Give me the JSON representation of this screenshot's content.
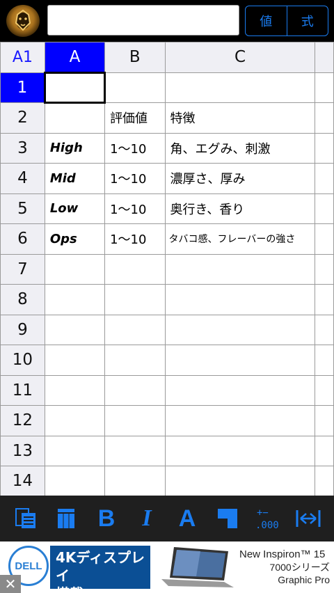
{
  "toolbar_top": {
    "formula_value": "",
    "mode_value": "値",
    "mode_formula": "式"
  },
  "grid": {
    "corner": "A1",
    "columns": [
      "A",
      "B",
      "C"
    ],
    "rows": [
      {
        "num": "1",
        "a": "",
        "b": "",
        "c": ""
      },
      {
        "num": "2",
        "a": "",
        "b": "評価値",
        "c": "特徴"
      },
      {
        "num": "3",
        "a": "High",
        "b": "1〜10",
        "c": "角、エグみ、刺激"
      },
      {
        "num": "4",
        "a": "Mid",
        "b": "1〜10",
        "c": "濃厚さ、厚み"
      },
      {
        "num": "5",
        "a": "Low",
        "b": "1〜10",
        "c": "奥行き、香り"
      },
      {
        "num": "6",
        "a": "Ops",
        "b": "1〜10",
        "c": "タバコ感、フレーバーの強さ"
      },
      {
        "num": "7",
        "a": "",
        "b": "",
        "c": ""
      },
      {
        "num": "8",
        "a": "",
        "b": "",
        "c": ""
      },
      {
        "num": "9",
        "a": "",
        "b": "",
        "c": ""
      },
      {
        "num": "10",
        "a": "",
        "b": "",
        "c": ""
      },
      {
        "num": "11",
        "a": "",
        "b": "",
        "c": ""
      },
      {
        "num": "12",
        "a": "",
        "b": "",
        "c": ""
      },
      {
        "num": "13",
        "a": "",
        "b": "",
        "c": ""
      },
      {
        "num": "14",
        "a": "",
        "b": "",
        "c": ""
      },
      {
        "num": "",
        "a": "",
        "b": "",
        "c": ""
      }
    ]
  },
  "format_toolbar": {
    "bold": "B",
    "italic": "I",
    "text_color": "A",
    "decimal": "+−\n.000",
    "icons": [
      "sheet-list-icon",
      "column-icon",
      "bold-icon",
      "italic-icon",
      "text-color-icon",
      "fill-color-icon",
      "decimal-icon",
      "fit-width-icon"
    ]
  },
  "ad": {
    "brand": "DELL",
    "headline_1": "4Kディスプレイ",
    "headline_2": "搭載",
    "product_1": "New Inspiron™ 15",
    "product_2": "7000シリーズ",
    "product_3": "Graphic Pro",
    "close": "✕"
  },
  "colors": {
    "accent": "#1a7cf0",
    "selection": "#0000ff",
    "toolbar_bg": "#1f1f1f"
  }
}
